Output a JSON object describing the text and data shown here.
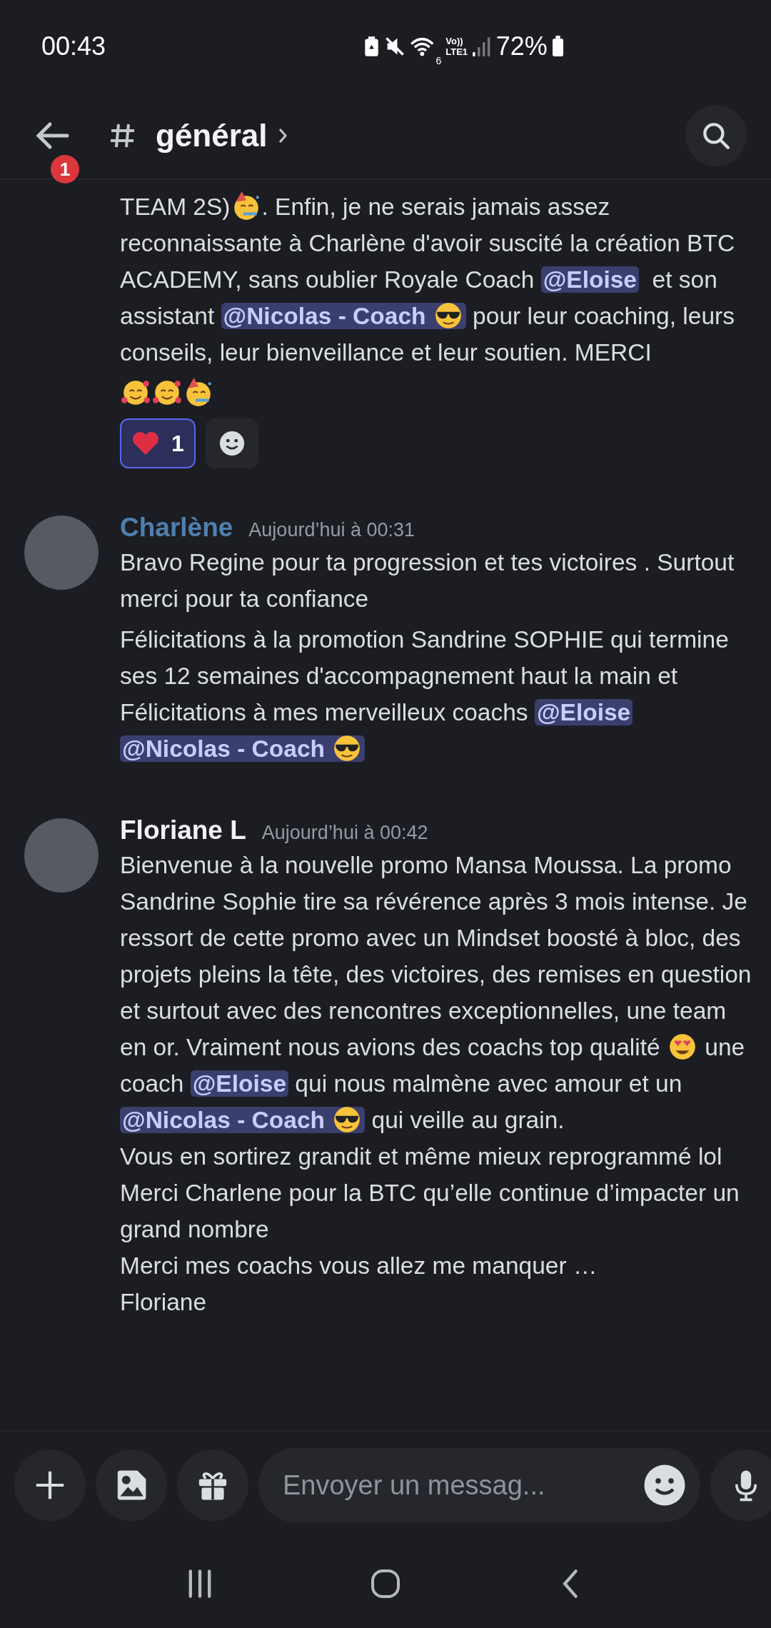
{
  "status_bar": {
    "time": "00:43",
    "wifi_badge": "6",
    "volte": "Vo))",
    "lte": "LTE1",
    "battery": "72%"
  },
  "header": {
    "badge": "1",
    "channel": "général"
  },
  "messages": [
    {
      "paragraphs": [
        [
          {
            "kind": "text",
            "text": "TEAM 2S)"
          },
          {
            "kind": "party"
          },
          {
            "kind": "text",
            "text": ". Enfin, je ne serais jamais assez reconnaissante à Charlène d'avoir suscité la création BTC ACADEMY, sans oublier Royale Coach "
          },
          {
            "kind": "mention",
            "text": "@Eloise"
          },
          {
            "kind": "text",
            "text": "  et son assistant "
          },
          {
            "kind": "mention",
            "text": "@Nicolas - Coach",
            "sunglasses": true
          },
          {
            "kind": "text",
            "text": " pour leur coaching, leurs conseils, leur bienveillance et leur soutien. MERCI"
          }
        ],
        [
          {
            "kind": "hearts"
          },
          {
            "kind": "hearts"
          },
          {
            "kind": "party"
          }
        ]
      ],
      "reactions": [
        {
          "kind": "heart",
          "count": "1",
          "selected": true
        }
      ]
    },
    {
      "author": "Charlène",
      "color": "#4f7fae",
      "time": "Aujourd’hui à 00:31",
      "paragraphs": [
        [
          {
            "kind": "text",
            "text": "Bravo Regine pour ta progression et tes victoires . Surtout merci pour ta confiance"
          }
        ],
        [
          {
            "kind": "text",
            "text": "Félicitations à la promotion Sandrine SOPHIE qui termine ses 12 semaines d'accompagnement haut la main et Félicitations à mes merveilleux coachs "
          },
          {
            "kind": "mention",
            "text": "@Eloise"
          },
          {
            "kind": "mention",
            "text": "@Nicolas - Coach",
            "sunglasses": true
          }
        ]
      ]
    },
    {
      "author": "Floriane L",
      "color": "#f2f3f5",
      "time": "Aujourd’hui à 00:42",
      "paragraphs": [
        [
          {
            "kind": "text",
            "text": "Bienvenue à la nouvelle promo Mansa Moussa. La promo Sandrine Sophie tire sa révérence après 3 mois intense. Je ressort de cette promo avec un Mindset boosté à bloc, des projets pleins la tête, des victoires, des remises en question et surtout avec des rencontres exceptionnelles, une team en or. Vraiment nous avions des coachs top qualité "
          },
          {
            "kind": "hearteyes"
          },
          {
            "kind": "text",
            "text": " une coach "
          },
          {
            "kind": "mention",
            "text": "@Eloise"
          },
          {
            "kind": "text",
            "text": " qui nous malmène avec amour et un "
          },
          {
            "kind": "mention",
            "text": "@Nicolas - Coach",
            "sunglasses": true
          },
          {
            "kind": "text",
            "text": " qui veille au grain.\nVous en sortirez grandit et même mieux reprogrammé lol\nMerci Charlene pour la BTC qu’elle continue d’impacter un grand nombre\nMerci mes coachs vous allez me manquer …\nFloriane"
          }
        ]
      ]
    }
  ],
  "composer": {
    "placeholder": "Envoyer un messag..."
  }
}
